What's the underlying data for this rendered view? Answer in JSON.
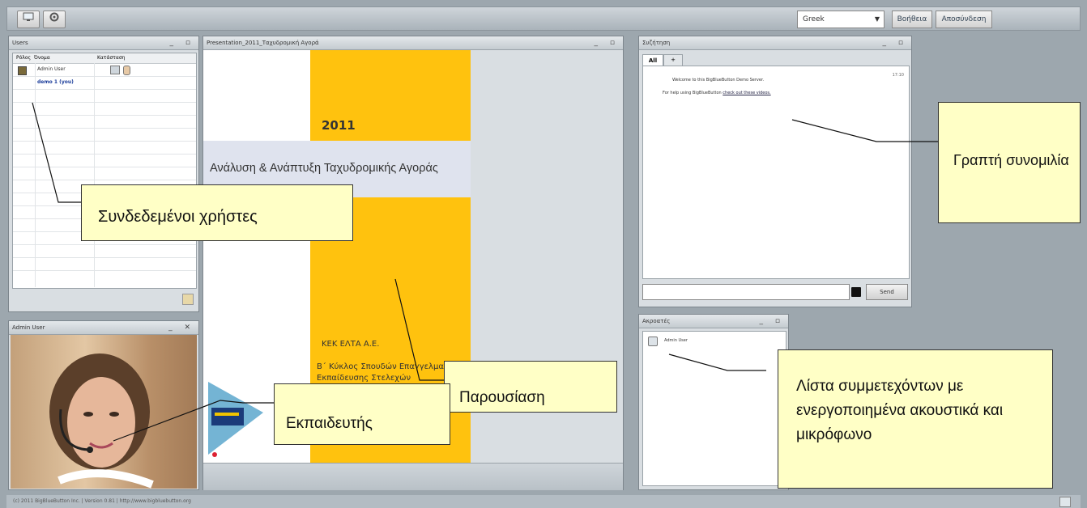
{
  "toolbar": {
    "language": "Greek",
    "help_label": "Βοήθεια",
    "logout_label": "Αποσύνδεση"
  },
  "users_panel": {
    "title": "Users",
    "col_role": "Ρόλος",
    "col_name": "Όνομα",
    "col_status": "Κατάσταση",
    "rows": [
      {
        "name": "Admin User"
      },
      {
        "name": "demo 1 (you)"
      }
    ]
  },
  "webcam_panel": {
    "title": "Admin User"
  },
  "presentation_panel": {
    "title": "Presentation_2011_Ταχυδρομική Αγορά",
    "slide_year": "2011",
    "slide_title": "Ανάλυση & Ανάπτυξη Ταχυδρομικής Αγοράς",
    "slide_org": "ΚΕΚ ΕΛΤΑ Α.Ε.",
    "slide_line2": "Β΄ Κύκλος Σπουδών Επαγγελματ",
    "slide_line3": "Εκπαίδευσης Στελεχών"
  },
  "chat_panel": {
    "title": "Συζήτηση",
    "tab_all": "All",
    "tab_plus": "+",
    "timestamp": "17:10",
    "message1": "Welcome to this BigBlueButton Demo Server.",
    "message2_prefix": "For help using BigBlueButton ",
    "message2_link": "check out these videos.",
    "send_label": "Send"
  },
  "listeners_panel": {
    "title": "Ακροατές",
    "items": [
      {
        "name": "Admin User"
      }
    ]
  },
  "callouts": {
    "users": "Συνδεδεμένοι χρήστες",
    "chat": "Γραπτή συνομιλία",
    "presentation": "Παρουσίαση",
    "trainer": "Εκπαιδευτής",
    "listeners": "Λίστα συμμετεχόντων με ενεργοποιημένα ακουστικά και μικρόφωνο"
  },
  "footer": {
    "text": "(c) 2011 BigBlueButton Inc. | Version 0.81 | http://www.bigbluebutton.org"
  }
}
